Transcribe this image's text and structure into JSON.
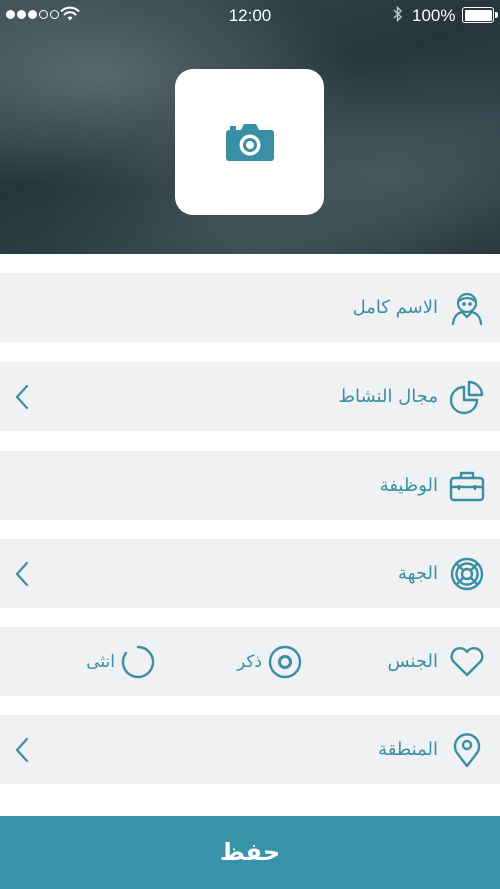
{
  "status_bar": {
    "time": "12:00",
    "battery": "100%",
    "signal_bars": 3,
    "signal_total": 5
  },
  "header": {
    "photo_picker_icon": "camera-icon"
  },
  "colors": {
    "accent": "#3b8fa5",
    "save_button": "#3793aa",
    "row_background": "#f0f1f3"
  },
  "form": {
    "full_name": {
      "label": "الاسم كامل",
      "icon": "user-icon"
    },
    "activity_field": {
      "label": "مجال النشاط",
      "icon": "pie-chart-icon"
    },
    "job": {
      "label": "الوظيفة",
      "icon": "briefcase-icon"
    },
    "organization": {
      "label": "الجهة",
      "icon": "lifebuoy-icon"
    },
    "gender": {
      "label": "الجنس",
      "icon": "heart-icon",
      "options": [
        {
          "label": "ذكر",
          "selected": true
        },
        {
          "label": "انثى",
          "selected": false
        }
      ]
    },
    "region": {
      "label": "المنطقة",
      "icon": "location-pin-icon"
    }
  },
  "save_label": "حفظ"
}
